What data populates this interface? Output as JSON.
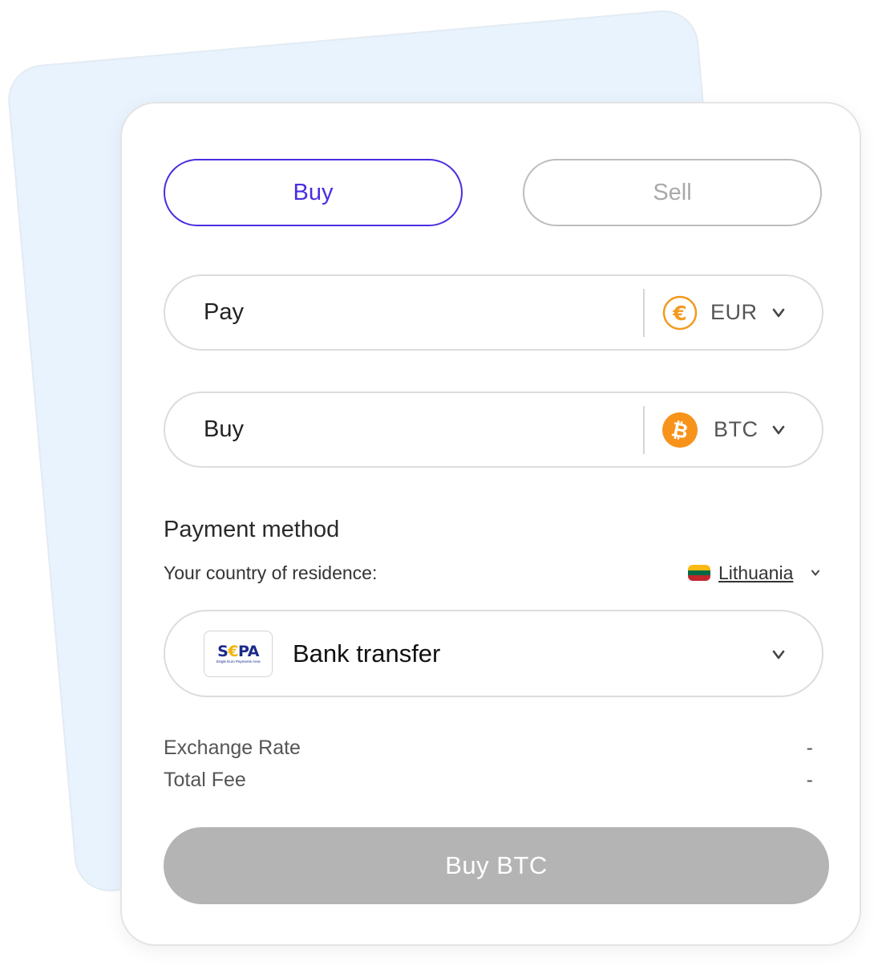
{
  "tabs": {
    "buy_label": "Buy",
    "sell_label": "Sell",
    "active": "Buy"
  },
  "pay_field": {
    "label": "Pay",
    "currency_code": "EUR",
    "currency_icon": "euro-coin-icon"
  },
  "buy_field": {
    "label": "Buy",
    "currency_code": "BTC",
    "currency_icon": "bitcoin-icon"
  },
  "payment": {
    "title": "Payment method",
    "country_label": "Your country of residence:",
    "country_name": "Lithuania",
    "country_flag": "lithuania-flag-icon",
    "method_label": "Bank transfer",
    "method_logo": "sepa-logo",
    "sepa_word_left": "S",
    "sepa_word_euro": "€",
    "sepa_word_right": "PA",
    "sepa_subtitle": "Single Euro Payments Area"
  },
  "summary": {
    "rate_label": "Exchange Rate",
    "rate_value": "-",
    "fee_label": "Total Fee",
    "fee_value": "-"
  },
  "cta": {
    "label": "Buy BTC"
  },
  "colors": {
    "accent": "#4a2ee0",
    "back_card": "#e8f3fd",
    "euro_orange": "#f39a1e",
    "bitcoin_orange": "#f7931a",
    "cta_disabled": "#b4b4b4"
  }
}
